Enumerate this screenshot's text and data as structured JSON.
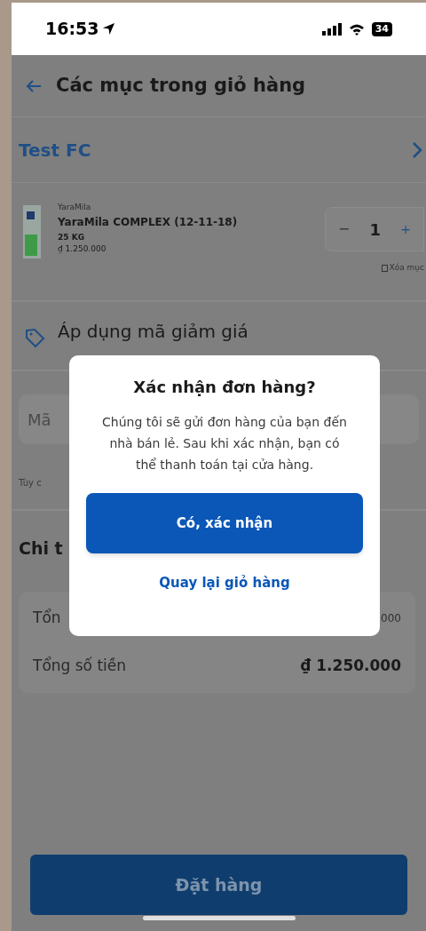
{
  "status_bar": {
    "time": "16:53",
    "battery": "34"
  },
  "header": {
    "title": "Các mục trong giỏ hàng"
  },
  "store": {
    "name": "Test FC"
  },
  "cart_item": {
    "brand": "YaraMila",
    "name": "YaraMila COMPLEX (12-11-18)",
    "weight": "25 KG",
    "price": "₫ 1.250.000",
    "quantity": "1",
    "minus": "−",
    "plus": "+",
    "remove": "Xóa mục"
  },
  "discount": {
    "title": "Áp dụng mã giảm giá"
  },
  "code_field": {
    "placeholder": "Mã"
  },
  "code_hint": "Tùy c",
  "details": {
    "title": "Chi t",
    "rows": [
      {
        "label": "Tổn",
        "value": "000",
        "bold": false
      },
      {
        "label": "Tổng số tiền",
        "value": "₫ 1.250.000",
        "bold": true
      }
    ]
  },
  "order_button": {
    "label": "Đặt hàng",
    "disabled": true
  },
  "dialog": {
    "title": "Xác nhận đơn hàng?",
    "message": "Chúng tôi sẽ gửi đơn hàng của bạn đến nhà bán lẻ. Sau khi xác nhận, bạn có thể thanh toán tại cửa hàng.",
    "confirm": "Có, xác nhận",
    "cancel": "Quay lại giỏ hàng"
  }
}
